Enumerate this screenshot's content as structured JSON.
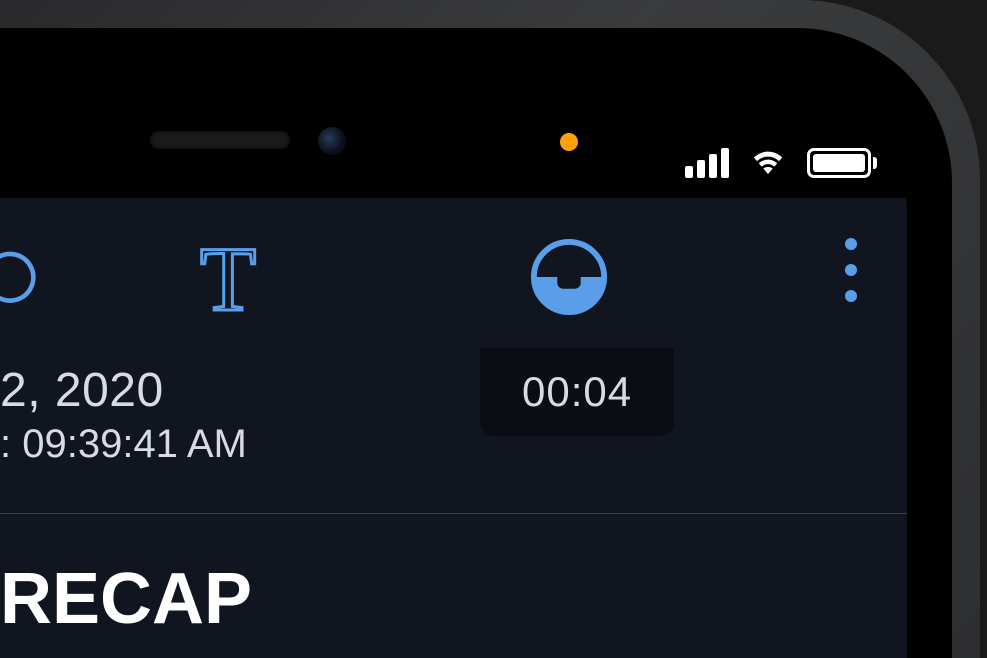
{
  "status": {
    "mic_indicator_color": "#ff9f0a",
    "cellular_bars": 4,
    "wifi_strength": 3,
    "battery_level": 100
  },
  "toolbar": {
    "undo": "undo",
    "text_tool": "T",
    "record": "record",
    "more": "more"
  },
  "recording": {
    "timer": "00:04"
  },
  "meta": {
    "date_fragment": "2, 2020",
    "time_fragment": ": 09:39:41 AM"
  },
  "content": {
    "heading_fragment": " RECAP"
  },
  "colors": {
    "accent": "#5a9de8",
    "app_bg": "#101520"
  }
}
